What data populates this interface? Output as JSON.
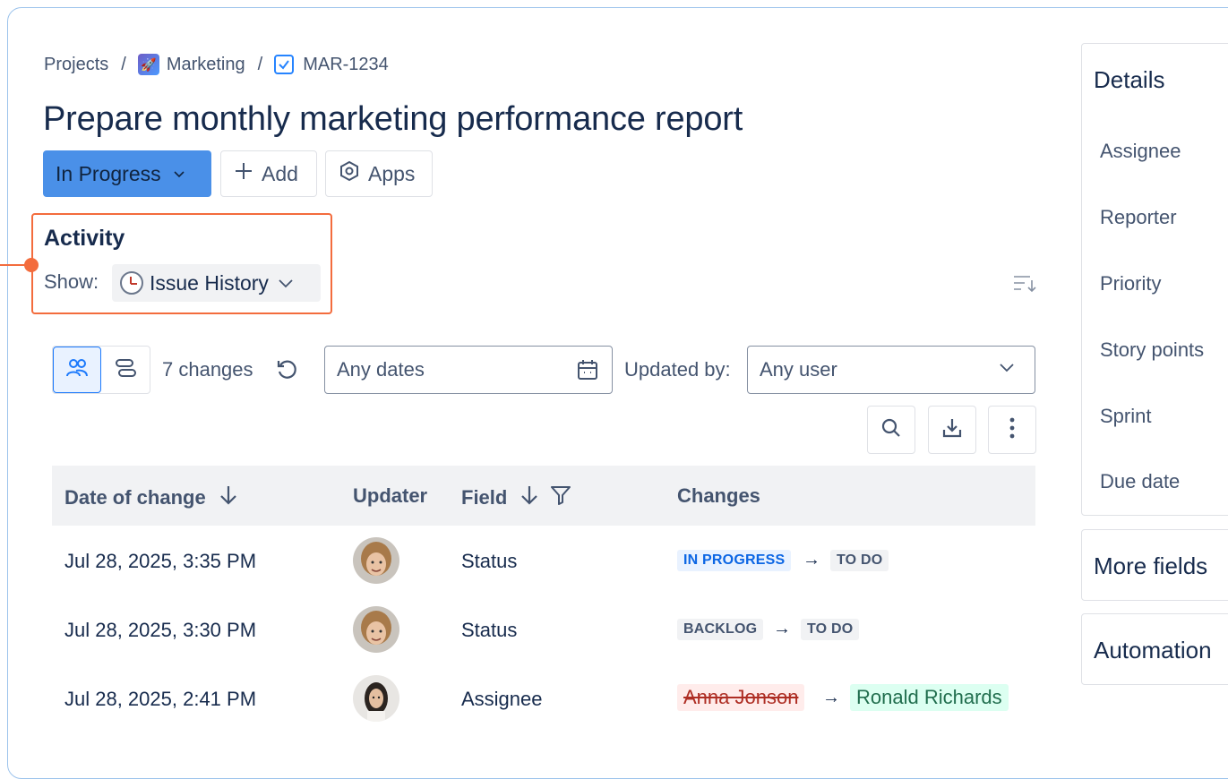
{
  "breadcrumb": {
    "projects": "Projects",
    "separator": "/",
    "project": "Marketing",
    "issue_key": "MAR-1234"
  },
  "issue": {
    "title": "Prepare monthly marketing performance report"
  },
  "actions": {
    "status": "In Progress",
    "add": "Add",
    "apps": "Apps"
  },
  "activity": {
    "heading": "Activity",
    "show_label": "Show:",
    "show_value": "Issue History"
  },
  "filters": {
    "changes_count": "7 changes",
    "dates_value": "Any dates",
    "updated_by_label": "Updated by:",
    "user_value": "Any user"
  },
  "table": {
    "columns": [
      "Date of change",
      "Updater",
      "Field",
      "Changes"
    ],
    "rows": [
      {
        "date": "Jul 28, 2025, 3:35 PM",
        "field": "Status",
        "from": "IN PROGRESS",
        "to": "TO DO"
      },
      {
        "date": "Jul 28, 2025, 3:30 PM",
        "field": "Status",
        "from": "BACKLOG",
        "to": "TO DO"
      },
      {
        "date": "Jul 28, 2025, 2:41 PM",
        "field": "Assignee",
        "from": "Anna Jonson",
        "to": "Ronald Richards"
      }
    ]
  },
  "details": {
    "title": "Details",
    "fields": [
      "Assignee",
      "Reporter",
      "Priority",
      "Story points",
      "Sprint",
      "Due date"
    ],
    "more_fields": "More fields",
    "automation": "Automation"
  },
  "colors": {
    "accent": "#1d7afc",
    "status_button": "#4a90e8",
    "annotation": "#f36c3d"
  }
}
